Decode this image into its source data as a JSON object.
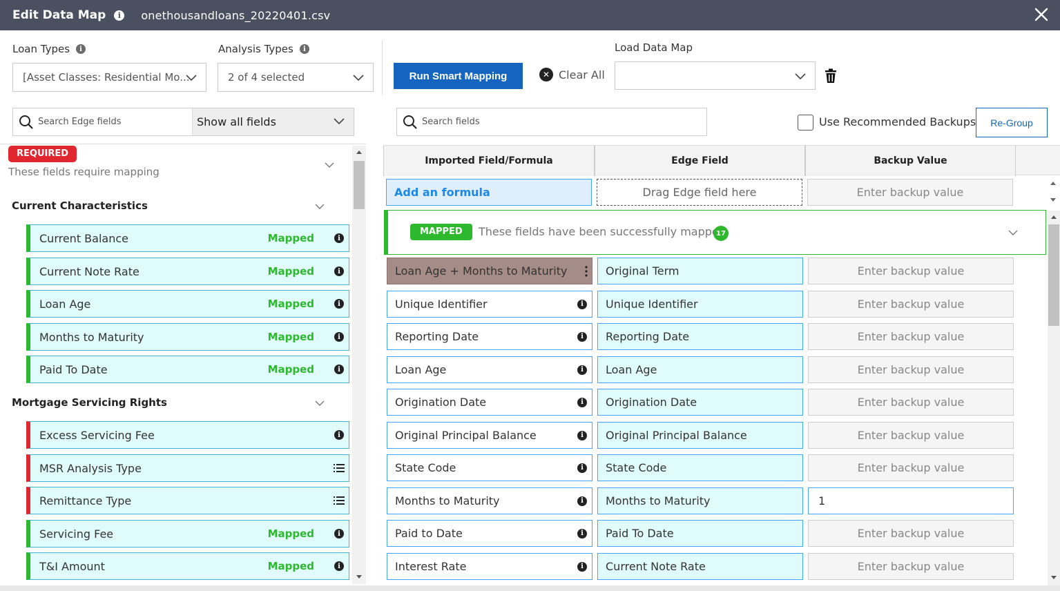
{
  "header": {
    "title": "Edit Data Map",
    "filename": "onethousandloans_20220401.csv"
  },
  "toolbar": {
    "loan_types_label": "Loan Types",
    "loan_types_value": "[Asset Classes: Residential Mo...",
    "analysis_types_label": "Analysis Types",
    "analysis_types_value": "2 of 4 selected",
    "run_smart_mapping": "Run Smart Mapping",
    "clear_all": "Clear All",
    "load_data_map_label": "Load Data Map",
    "load_data_map_value": ""
  },
  "left_panel": {
    "search_placeholder": "Search Edge fields",
    "filter_value": "Show all fields",
    "required_badge": "REQUIRED",
    "required_desc": "These fields require mapping",
    "sections": [
      {
        "title": "Current Characteristics",
        "fields": [
          {
            "label": "Current Balance",
            "status": "Mapped",
            "color": "#2eb82e"
          },
          {
            "label": "Current Note Rate",
            "status": "Mapped",
            "color": "#2eb82e"
          },
          {
            "label": "Loan Age",
            "status": "Mapped",
            "color": "#2eb82e"
          },
          {
            "label": "Months to Maturity",
            "status": "Mapped",
            "color": "#2eb82e"
          },
          {
            "label": "Paid To Date",
            "status": "Mapped",
            "color": "#2eb82e"
          }
        ]
      },
      {
        "title": "Mortgage Servicing Rights",
        "fields": [
          {
            "label": "Excess Servicing Fee",
            "status": "",
            "color": "#e0262f"
          },
          {
            "label": "MSR Analysis Type",
            "status": "",
            "color": "#e0262f"
          },
          {
            "label": "Remittance Type",
            "status": "",
            "color": "#e0262f"
          },
          {
            "label": "Servicing Fee",
            "status": "Mapped",
            "color": "#2eb82e"
          },
          {
            "label": "T&I Amount",
            "status": "Mapped",
            "color": "#2eb82e"
          }
        ]
      }
    ]
  },
  "right_panel": {
    "search_placeholder": "Search fields",
    "use_recommended_backups": "Use Recommended Backups",
    "regroup": "Re-Group",
    "columns": [
      "Imported Field/Formula",
      "Edge Field",
      "Backup Value"
    ],
    "add_formula": "Add an formula",
    "drag_edge_field": "Drag Edge field here",
    "backup_placeholder": "Enter backup value",
    "mapped_badge": "MAPPED",
    "mapped_desc": "These fields have been successfully mapped",
    "mapped_count": "17",
    "rows": [
      {
        "imported": "Loan Age + Months to Maturity",
        "edge": "Original Term",
        "backup": "",
        "formula": true
      },
      {
        "imported": "Unique Identifier",
        "edge": "Unique Identifier",
        "backup": ""
      },
      {
        "imported": "Reporting Date",
        "edge": "Reporting Date",
        "backup": ""
      },
      {
        "imported": "Loan Age",
        "edge": "Loan Age",
        "backup": ""
      },
      {
        "imported": "Origination Date",
        "edge": "Origination Date",
        "backup": ""
      },
      {
        "imported": "Original Principal Balance",
        "edge": "Original Principal Balance",
        "backup": ""
      },
      {
        "imported": "State Code",
        "edge": "State Code",
        "backup": ""
      },
      {
        "imported": "Months to Maturity",
        "edge": "Months to Maturity",
        "backup": "1"
      },
      {
        "imported": "Paid to Date",
        "edge": "Paid To Date",
        "backup": ""
      },
      {
        "imported": "Interest Rate",
        "edge": "Current Note Rate",
        "backup": ""
      }
    ]
  }
}
